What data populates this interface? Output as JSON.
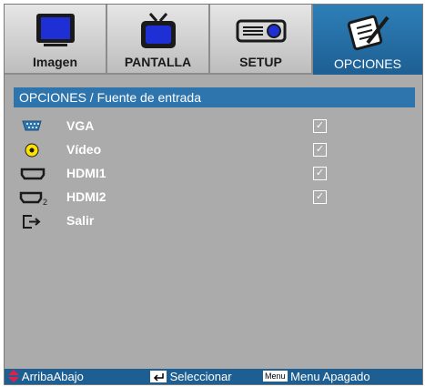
{
  "tabs": [
    {
      "label": "Imagen",
      "icon": "monitor-icon",
      "active": false
    },
    {
      "label": "PANTALLA",
      "icon": "tv-icon",
      "active": false
    },
    {
      "label": "SETUP",
      "icon": "projector-icon",
      "active": false
    },
    {
      "label": "OPCIONES",
      "icon": "notepad-pencil-icon",
      "active": true
    }
  ],
  "breadcrumb": "OPCIONES / Fuente de entrada",
  "items": [
    {
      "label": "VGA",
      "icon": "vga-port-icon",
      "checked": true
    },
    {
      "label": "Vídeo",
      "icon": "video-rca-icon",
      "checked": true
    },
    {
      "label": "HDMI1",
      "icon": "hdmi-port-icon",
      "checked": true
    },
    {
      "label": "HDMI2",
      "icon": "hdmi2-port-icon",
      "checked": true
    },
    {
      "label": "Salir",
      "icon": "exit-icon",
      "checked": false
    }
  ],
  "footer": {
    "nav_label": "ArribaAbajo",
    "select_label": "Seleccionar",
    "menu_key": "Menu",
    "menu_label": "Menu Apagado"
  },
  "colors": {
    "accent": "#2f75ad",
    "panel": "#ababab",
    "nav_arrow": "#e0204a"
  }
}
